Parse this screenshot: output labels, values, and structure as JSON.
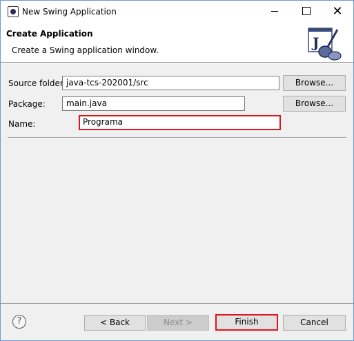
{
  "window": {
    "title": "New Swing Application",
    "minimize_glyph": "",
    "close_glyph": "✕"
  },
  "banner": {
    "title": "Create Application",
    "description": "Create a Swing application window.",
    "icon": "java-swing-wizard-icon"
  },
  "form": {
    "source_folder": {
      "label": "Source folder:",
      "value": "java-tcs-202001/src",
      "browse_label": "Browse..."
    },
    "package": {
      "label": "Package:",
      "value": "main.java",
      "browse_label": "Browse..."
    },
    "name": {
      "label": "Name:",
      "value": "Programa"
    }
  },
  "footer": {
    "help_glyph": "?",
    "back_label": "< Back",
    "next_label": "Next >",
    "finish_label": "Finish",
    "cancel_label": "Cancel"
  },
  "colors": {
    "highlight": "#e0141e",
    "dialog_bg": "#f0f0f0"
  }
}
